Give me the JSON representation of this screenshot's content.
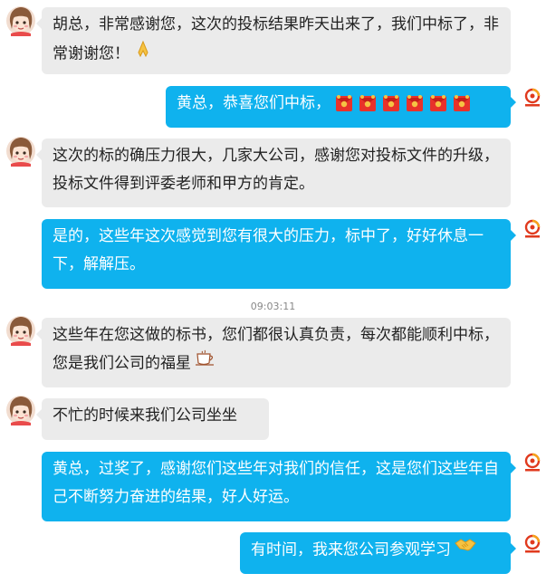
{
  "messages": [
    {
      "side": "in",
      "text": "胡总，非常感谢您，这次的投标结果昨天出来了，我们中标了，非常谢谢您！",
      "emoji": "pray-icon"
    },
    {
      "side": "out",
      "text": "黄总，恭喜您们中标，",
      "emoji": "red-envelope-icon x6"
    },
    {
      "side": "in",
      "text": "这次的标的确压力很大，几家大公司，感谢您对投标文件的升级，投标文件得到评委老师和甲方的肯定。"
    },
    {
      "side": "out",
      "text": "是的，这些年这次感觉到您有很大的压力，标中了，好好休息一下，解解压。"
    },
    {
      "side": "in",
      "text": "这些年在您这做的标书，您们都很认真负责，每次都能顺利中标，您是我们公司的福星",
      "emoji": "coffee-icon"
    },
    {
      "side": "in",
      "text": "不忙的时候来我们公司坐坐"
    },
    {
      "side": "out",
      "text": "黄总，过奖了，感谢您们这些年对我们的信任，这是您们这些年自己不断努力奋进的结果，好人好运。"
    },
    {
      "side": "out",
      "text": "有时间，我来您公司参观学习",
      "emoji": "handshake-icon"
    }
  ],
  "timestamp": "09:03:11",
  "colors": {
    "incoming": "#ebebeb",
    "outgoing": "#0fb2ee",
    "outgoing_text": "#ffffff"
  }
}
